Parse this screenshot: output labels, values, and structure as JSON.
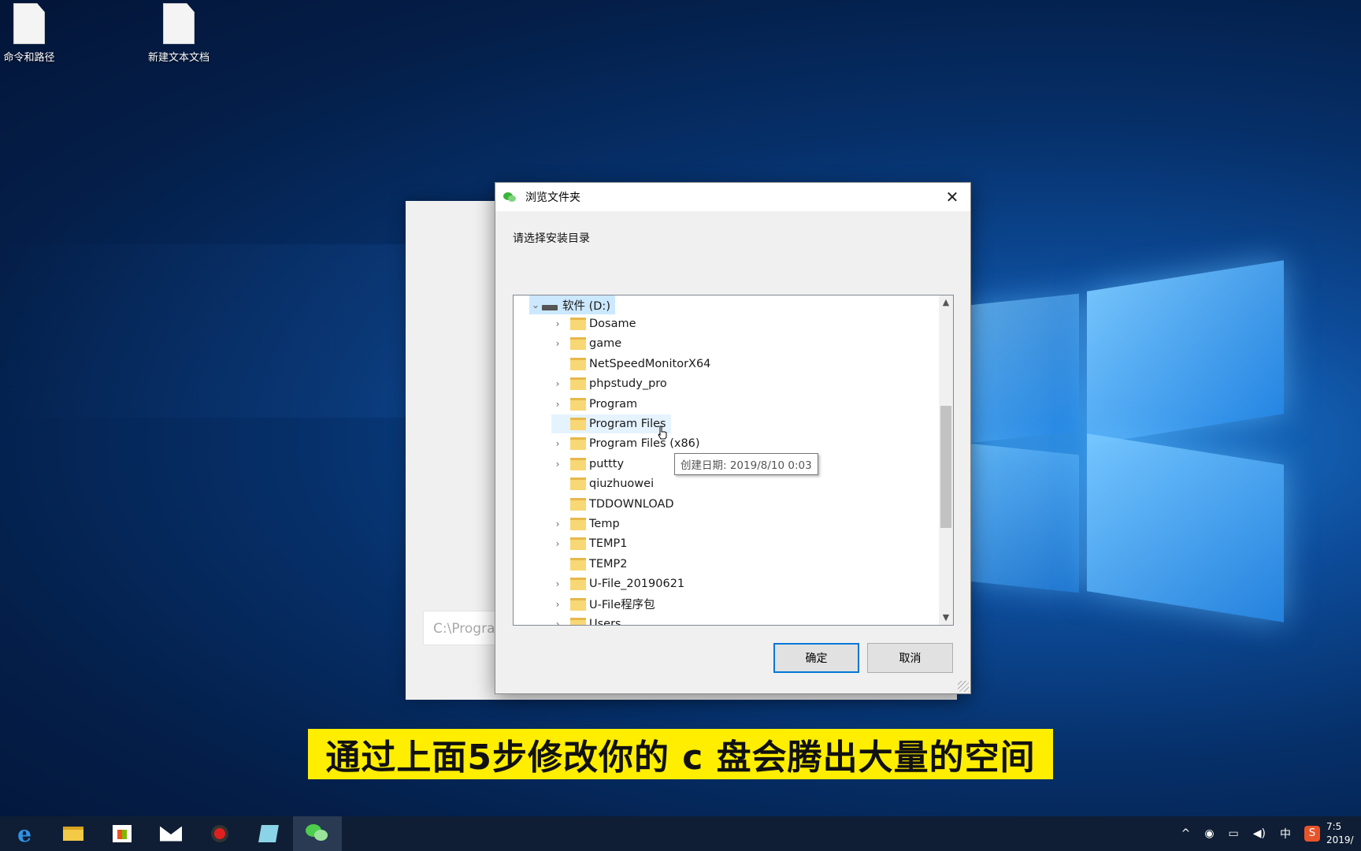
{
  "desktop": {
    "icons": [
      {
        "label": "命令和路径",
        "icon": "text-document-icon"
      },
      {
        "label": "新建文本文档",
        "icon": "text-document-icon"
      }
    ]
  },
  "installer": {
    "path_value": "C:\\Progra"
  },
  "dialog": {
    "title": "浏览文件夹",
    "close_glyph": "✕",
    "instruction": "请选择安装目录",
    "tree": {
      "drive_label": "软件 (D:)",
      "items": [
        {
          "label": "Dosame",
          "expandable": true
        },
        {
          "label": "game",
          "expandable": true
        },
        {
          "label": "NetSpeedMonitorX64",
          "expandable": false
        },
        {
          "label": "phpstudy_pro",
          "expandable": true
        },
        {
          "label": "Program",
          "expandable": true
        },
        {
          "label": "Program Files",
          "expandable": false,
          "hovered": true
        },
        {
          "label": "Program Files (x86)",
          "expandable": true
        },
        {
          "label": "puttty",
          "expandable": true
        },
        {
          "label": "qiuzhuowei",
          "expandable": false
        },
        {
          "label": "TDDOWNLOAD",
          "expandable": false
        },
        {
          "label": "Temp",
          "expandable": true
        },
        {
          "label": "TEMP1",
          "expandable": true
        },
        {
          "label": "TEMP2",
          "expandable": false
        },
        {
          "label": "U-File_20190621",
          "expandable": true
        },
        {
          "label": "U-File程序包",
          "expandable": true
        },
        {
          "label": "Users",
          "expandable": true
        }
      ]
    },
    "tooltip": "创建日期: 2019/8/10 0:03",
    "ok_label": "确定",
    "cancel_label": "取消"
  },
  "caption": "通过上面5步修改你的 c 盘会腾出大量的空间",
  "taskbar": {
    "apps": [
      "edge-icon",
      "file-explorer-icon",
      "store-icon",
      "mail-icon",
      "recorder-icon",
      "notes-icon",
      "wechat-icon"
    ],
    "tray": {
      "chevron": "^",
      "ime": "中",
      "sogou": "S",
      "time": "7:5",
      "date": "2019/"
    }
  },
  "colors": {
    "accent": "#0078d7",
    "caption_bg": "#ffee00",
    "taskbar_bg": "#0f1e34"
  }
}
